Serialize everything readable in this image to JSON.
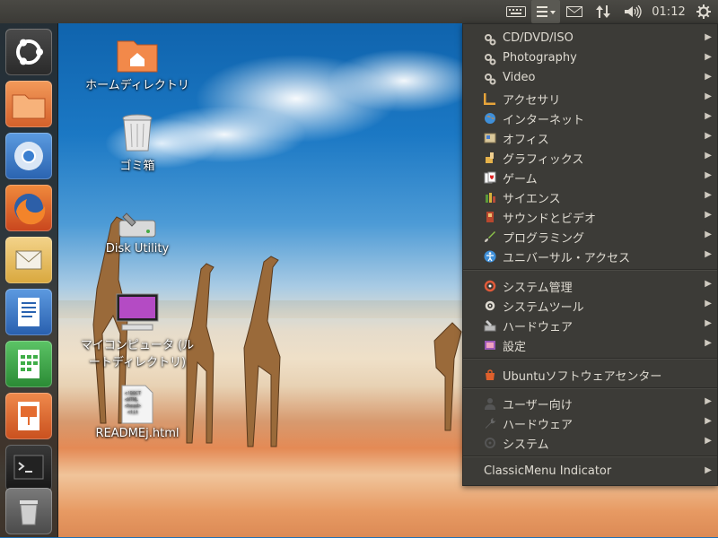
{
  "panel": {
    "clock": "01:12",
    "icons": [
      "keyboard-icon",
      "classicmenu-icon",
      "mail-icon",
      "network-icon",
      "volume-icon",
      "gear-icon"
    ]
  },
  "launcher": {
    "items": [
      {
        "name": "dash-home",
        "color": "#3b3b3b"
      },
      {
        "name": "files",
        "color": "#e8743a"
      },
      {
        "name": "chromium",
        "color": "#3a7fd0"
      },
      {
        "name": "firefox",
        "color": "#e0602c"
      },
      {
        "name": "mail",
        "color": "#e9c36a"
      },
      {
        "name": "libreoffice-writer",
        "color": "#3a7fcf"
      },
      {
        "name": "libreoffice-calc",
        "color": "#3fae48"
      },
      {
        "name": "libreoffice-impress",
        "color": "#e46c30"
      },
      {
        "name": "terminal",
        "color": "#2b2b2b"
      },
      {
        "name": "trash",
        "color": "#6a6a6a"
      }
    ]
  },
  "desktop": {
    "icons": [
      {
        "label": "ホームディレクトリ"
      },
      {
        "label": "ゴミ箱"
      },
      {
        "label": "Disk Utility"
      },
      {
        "label": "マイコンピュータ (ルートディレクトリ)"
      },
      {
        "label": "READMEj.html"
      }
    ]
  },
  "menu": {
    "group1": [
      {
        "label": "CD/DVD/ISO",
        "icon": "gears-icon"
      },
      {
        "label": "Photography",
        "icon": "gears-icon"
      },
      {
        "label": "Video",
        "icon": "gears-icon"
      },
      {
        "label": "アクセサリ",
        "icon": "accessories-icon"
      },
      {
        "label": "インターネット",
        "icon": "globe-icon"
      },
      {
        "label": "オフィス",
        "icon": "office-icon"
      },
      {
        "label": "グラフィックス",
        "icon": "graphics-icon"
      },
      {
        "label": "ゲーム",
        "icon": "cards-icon"
      },
      {
        "label": "サイエンス",
        "icon": "science-icon"
      },
      {
        "label": "サウンドとビデオ",
        "icon": "multimedia-icon"
      },
      {
        "label": "プログラミング",
        "icon": "brush-icon"
      },
      {
        "label": "ユニバーサル・アクセス",
        "icon": "accessibility-icon"
      }
    ],
    "group2": [
      {
        "label": "システム管理",
        "icon": "admin-icon"
      },
      {
        "label": "システムツール",
        "icon": "gear-icon"
      },
      {
        "label": "ハードウェア",
        "icon": "hardware-icon"
      },
      {
        "label": "設定",
        "icon": "settings-icon"
      }
    ],
    "software_center": {
      "label": "Ubuntuソフトウェアセンター",
      "icon": "bag-icon"
    },
    "group3": [
      {
        "label": "ユーザー向け",
        "icon": "user-icon"
      },
      {
        "label": "ハードウェア",
        "icon": "wrench-icon"
      },
      {
        "label": "システム",
        "icon": "system-icon"
      }
    ],
    "footer": {
      "label": "ClassicMenu Indicator"
    },
    "arrow": "▶"
  }
}
